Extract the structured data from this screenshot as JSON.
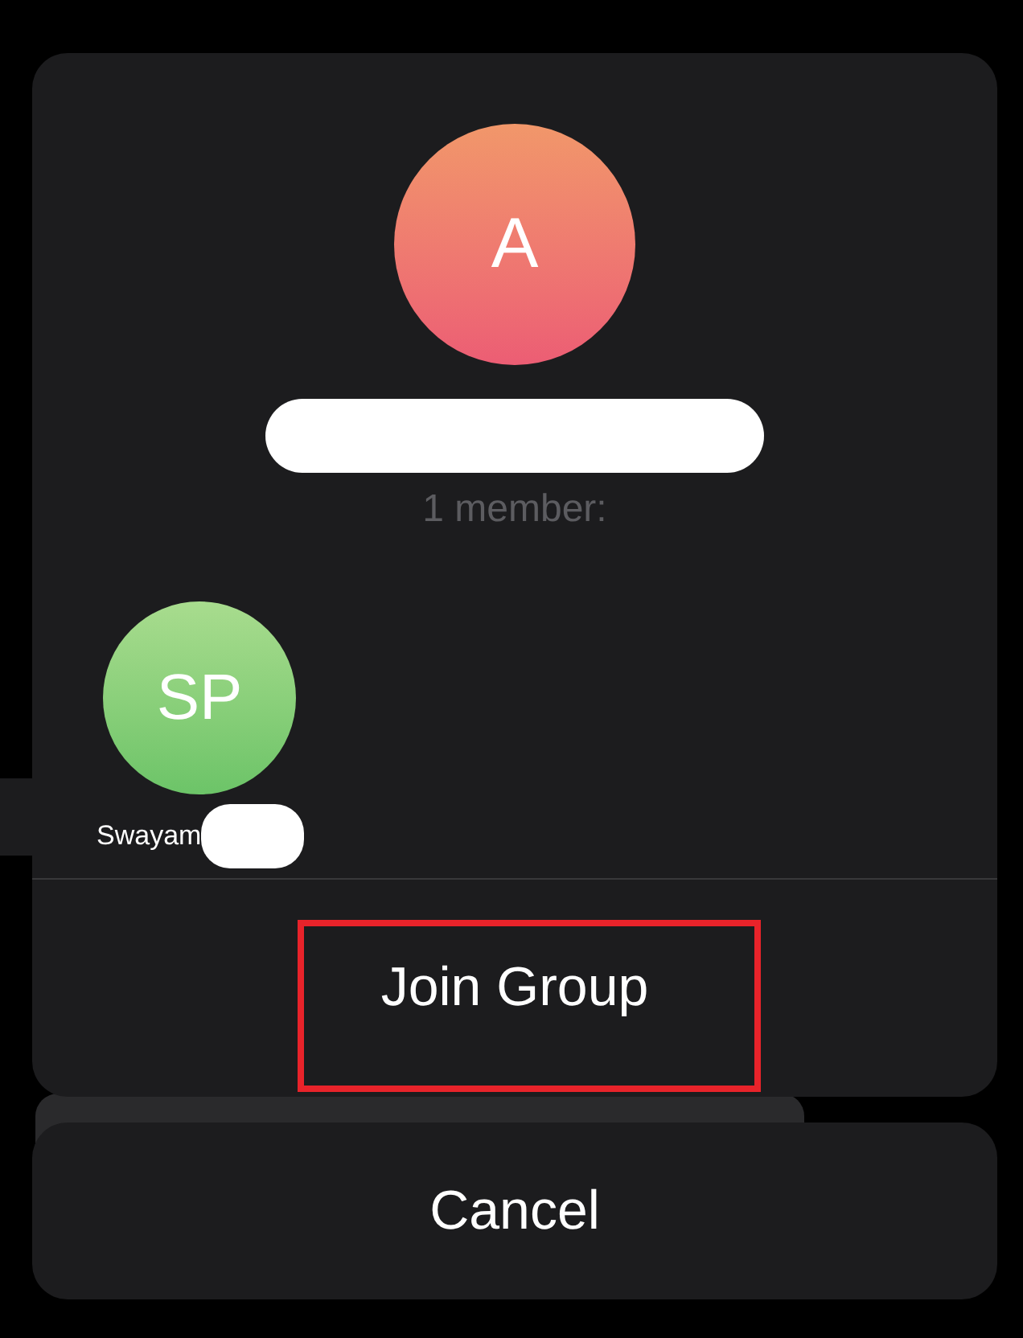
{
  "group": {
    "avatar_letter": "A",
    "member_count": "1 member:",
    "members": [
      {
        "initials": "SP",
        "name": "Swayam"
      }
    ]
  },
  "actions": {
    "join": "Join Group",
    "cancel": "Cancel"
  }
}
